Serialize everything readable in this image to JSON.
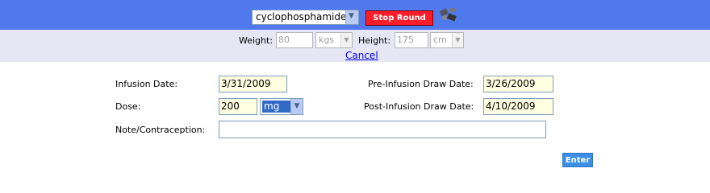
{
  "header": {
    "drug_select_value": "cyclophosphamide",
    "stop_round_label": "Stop Round",
    "tools_icon": "tools-icon"
  },
  "body_metrics": {
    "weight_label": "Weight:",
    "weight_value": "80",
    "weight_unit": "kgs",
    "height_label": "Height:",
    "height_value": "175",
    "height_unit": "cm",
    "cancel_label": "Cancel"
  },
  "form": {
    "infusion_date_label": "Infusion Date:",
    "infusion_date_value": "3/31/2009",
    "pre_draw_label": "Pre-Infusion Draw Date:",
    "pre_draw_value": "3/26/2009",
    "dose_label": "Dose:",
    "dose_value": "200",
    "dose_unit": "mg",
    "post_draw_label": "Post-Infusion Draw Date:",
    "post_draw_value": "4/10/2009",
    "note_label": "Note/Contraception:",
    "note_value": "",
    "enter_label": "Enter"
  },
  "colors": {
    "topbar": "#5079ee",
    "secondbar": "#e6e6f5",
    "stop_button": "#ff1d2a",
    "date_field": "#ffffe1",
    "enter_button": "#3d8fe6"
  }
}
